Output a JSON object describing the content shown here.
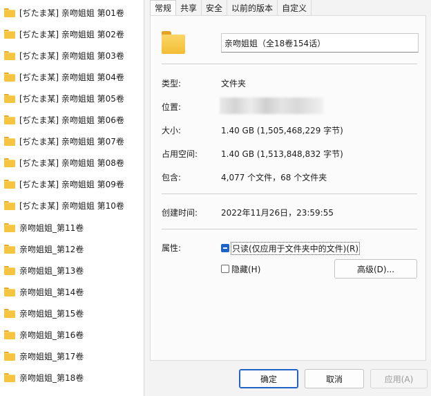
{
  "file_list": {
    "items": [
      "[ぢたま某] 亲吻姐姐 第01卷",
      "[ぢたま某] 亲吻姐姐 第02卷",
      "[ぢたま某] 亲吻姐姐 第03卷",
      "[ぢたま某] 亲吻姐姐 第04卷",
      "[ぢたま某] 亲吻姐姐 第05卷",
      "[ぢたま某] 亲吻姐姐 第06卷",
      "[ぢたま某] 亲吻姐姐 第07卷",
      "[ぢたま某] 亲吻姐姐 第08卷",
      "[ぢたま某] 亲吻姐姐 第09卷",
      "[ぢたま某] 亲吻姐姐 第10卷",
      "亲吻姐姐_第11卷",
      "亲吻姐姐_第12卷",
      "亲吻姐姐_第13卷",
      "亲吻姐姐_第14卷",
      "亲吻姐姐_第15卷",
      "亲吻姐姐_第16卷",
      "亲吻姐姐_第17卷",
      "亲吻姐姐_第18卷"
    ]
  },
  "dialog": {
    "tabs": [
      "常规",
      "共享",
      "安全",
      "以前的版本",
      "自定义"
    ],
    "active_tab": "常规",
    "folder_name": "亲吻姐姐（全18卷154话）",
    "type": {
      "label": "类型:",
      "value": "文件夹"
    },
    "location": {
      "label": "位置:",
      "value": ""
    },
    "size": {
      "label": "大小:",
      "value": "1.40 GB (1,505,468,229 字节)"
    },
    "size_on_disk": {
      "label": "占用空间:",
      "value": "1.40 GB (1,513,848,832 字节)"
    },
    "contains": {
      "label": "包含:",
      "value": "4,077 个文件，68 个文件夹"
    },
    "created": {
      "label": "创建时间:",
      "value": "2022年11月26日，23:59:55"
    },
    "attributes": {
      "label": "属性:",
      "readonly_label": "只读(仅应用于文件夹中的文件)(R)",
      "readonly_state": "indeterminate",
      "hidden_label": "隐藏(H)",
      "hidden_checked": false,
      "advanced_button": "高级(D)..."
    },
    "buttons": {
      "ok": "确定",
      "cancel": "取消",
      "apply": "应用(A)"
    },
    "colors": {
      "accent": "#1f63c6",
      "folder": "#f5c440"
    }
  }
}
